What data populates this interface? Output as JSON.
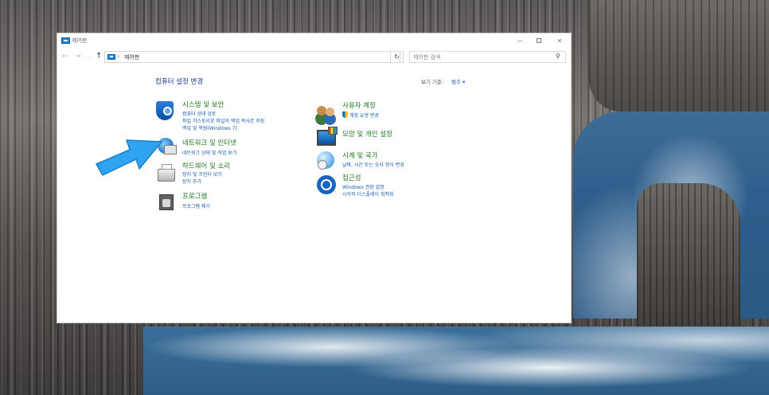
{
  "window": {
    "title": "제어판",
    "controls": {
      "minimize": "—",
      "maximize": "",
      "close": "✕"
    }
  },
  "navigation": {
    "back": "←",
    "forward": "→",
    "recent": "⌄",
    "up": "↑",
    "breadcrumb_separator": "›",
    "address": "제어판",
    "dropdown": "⌄",
    "refresh": "↻",
    "search_placeholder": "제어판 검색",
    "search_icon": "⚲"
  },
  "header": {
    "title": "컴퓨터 설정 변경",
    "view_by_label": "보기 기준:",
    "view_by_value": "범주 ▾"
  },
  "categories_left": [
    {
      "title": "시스템 및 보안",
      "icon": "security-shield-icon",
      "links": [
        "컴퓨터 상태 검토",
        "파일 히스토리로 파일의 백업 복사본 저장",
        "백업 및 복원(Windows 7)"
      ]
    },
    {
      "title": "네트워크 및 인터넷",
      "icon": "network-globe-icon",
      "links": [
        "네트워크 상태 및 작업 보기"
      ]
    },
    {
      "title": "하드웨어 및 소리",
      "icon": "printer-icon",
      "links": [
        "장치 및 프린터 보기",
        "장치 추가"
      ]
    },
    {
      "title": "프로그램",
      "icon": "programs-icon",
      "links": [
        "프로그램 제거"
      ]
    }
  ],
  "categories_right": [
    {
      "title": "사용자 계정",
      "icon": "users-icon",
      "links": [
        "계정 유형 변경"
      ]
    },
    {
      "title": "모양 및 개인 설정",
      "icon": "appearance-icon",
      "links": []
    },
    {
      "title": "시계 및 국가",
      "icon": "clock-globe-icon",
      "links": [
        "날짜, 시간 또는 숫자 형식 변경"
      ]
    },
    {
      "title": "접근성",
      "icon": "accessibility-icon",
      "links": [
        "Windows 권장 설정",
        "시각적 디스플레이 최적화"
      ]
    }
  ],
  "colors": {
    "category_title": "#1e7a1e",
    "link": "#1a5fb4",
    "heading": "#1f3a93",
    "annotation_arrow": "#2ea3f2"
  }
}
